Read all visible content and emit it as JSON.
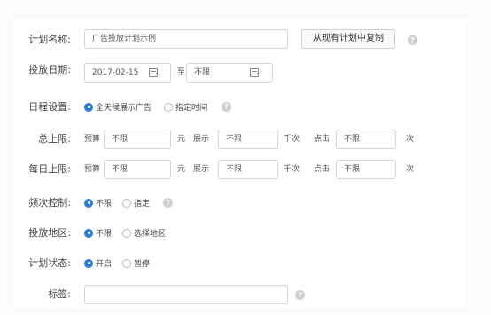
{
  "plan_name": {
    "label": "计划名称:",
    "value": "广告投放计划示例",
    "copy_button": "从现有计划中复制"
  },
  "schedule_dates": {
    "label": "投放日期:",
    "start": "2017-02-15",
    "to": "至",
    "end": "不限"
  },
  "daily_schedule": {
    "label": "日程设置:",
    "options": [
      "全天候展示广告",
      "指定时间"
    ],
    "selected": "全天候展示广告"
  },
  "total_limit": {
    "label": "总上限:",
    "budget_label": "预算",
    "budget_value": "不限",
    "budget_unit": "元",
    "impressions_label": "展示",
    "impressions_value": "不限",
    "impressions_unit": "千次",
    "clicks_label": "点击",
    "clicks_value": "不限",
    "clicks_unit": "次"
  },
  "daily_limit": {
    "label": "每日上限:",
    "budget_label": "预算",
    "budget_value": "不限",
    "budget_unit": "元",
    "impressions_label": "展示",
    "impressions_value": "不限",
    "impressions_unit": "千次",
    "clicks_label": "点击",
    "clicks_value": "不限",
    "clicks_unit": "次"
  },
  "frequency": {
    "label": "频次控制:",
    "options": [
      "不限",
      "指定"
    ],
    "selected": "不限"
  },
  "region": {
    "label": "投放地区:",
    "options": [
      "不限",
      "选择地区"
    ],
    "selected": "不限"
  },
  "status": {
    "label": "计划状态:",
    "options": [
      "开启",
      "暂停"
    ],
    "selected": "开启"
  },
  "tags": {
    "label": "标签:",
    "value": ""
  },
  "help_glyph": "?",
  "colors": {
    "accent": "#2d7fd3",
    "border": "#d4d4d4",
    "help": "#cfcfcf"
  }
}
